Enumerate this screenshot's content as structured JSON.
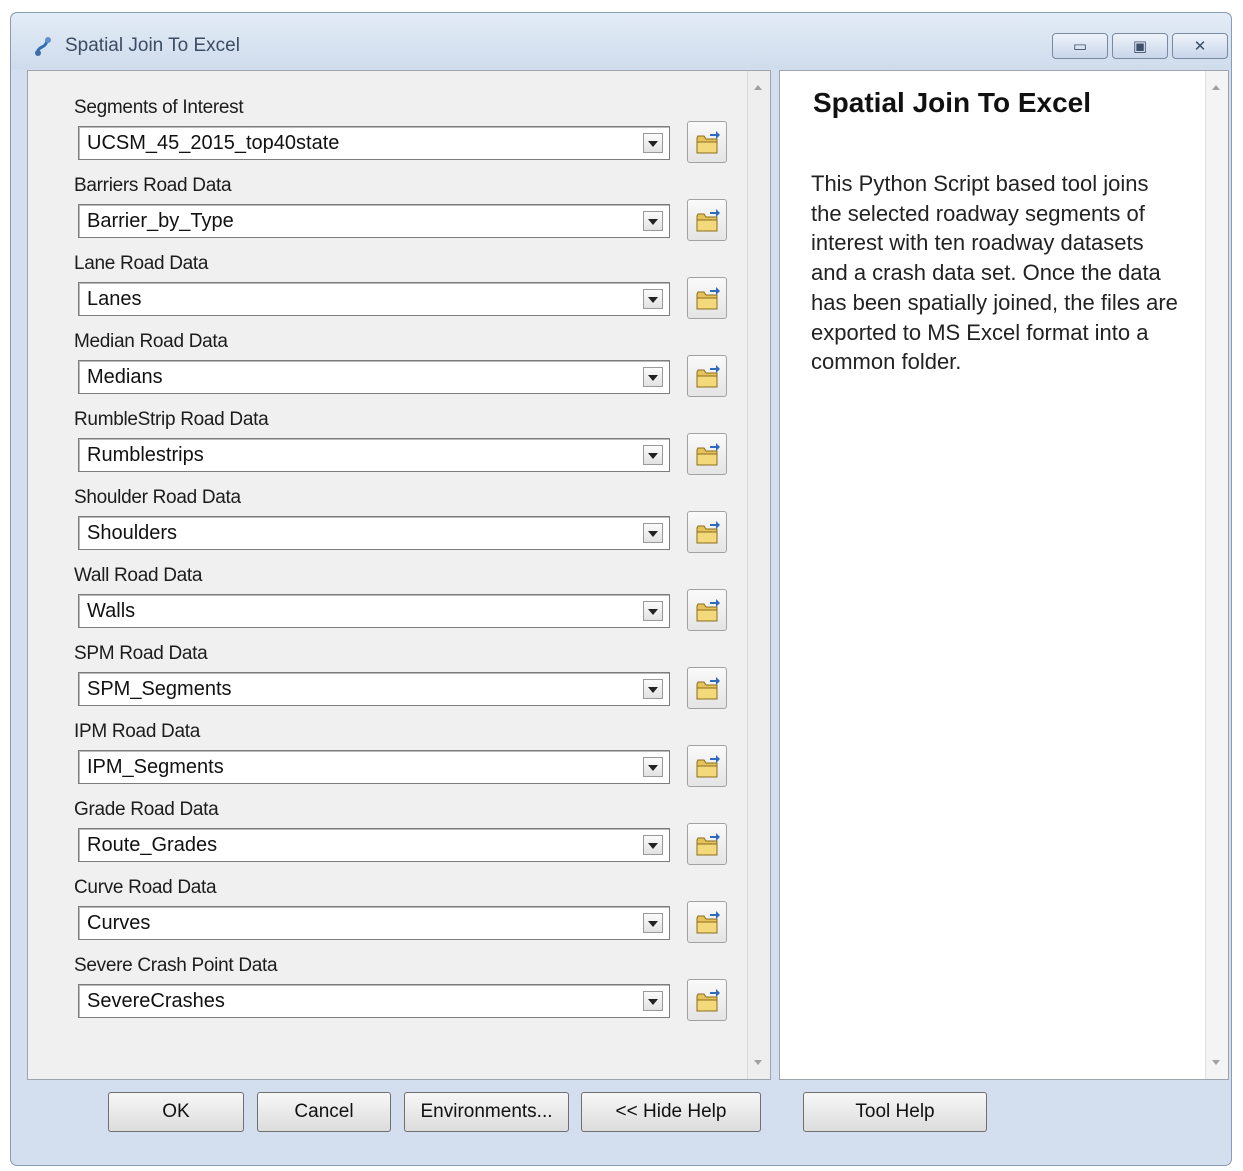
{
  "window": {
    "title": "Spatial Join To Excel",
    "controls": {
      "minimize": "▭",
      "maximize": "▣",
      "close": "✕"
    }
  },
  "fields": [
    {
      "label": "Segments of Interest",
      "value": "UCSM_45_2015_top40state"
    },
    {
      "label": "Barriers Road Data",
      "value": "Barrier_by_Type"
    },
    {
      "label": "Lane Road Data",
      "value": "Lanes"
    },
    {
      "label": "Median Road Data",
      "value": "Medians"
    },
    {
      "label": "RumbleStrip Road Data",
      "value": "Rumblestrips"
    },
    {
      "label": "Shoulder Road Data",
      "value": "Shoulders"
    },
    {
      "label": "Wall Road Data",
      "value": "Walls"
    },
    {
      "label": "SPM Road Data",
      "value": "SPM_Segments"
    },
    {
      "label": "IPM Road Data",
      "value": "IPM_Segments"
    },
    {
      "label": "Grade Road Data",
      "value": "Route_Grades"
    },
    {
      "label": "Curve Road Data",
      "value": "Curves"
    },
    {
      "label": "Severe Crash Point Data",
      "value": "SevereCrashes"
    }
  ],
  "help": {
    "title": "Spatial Join To Excel",
    "body": "This Python Script based tool joins the selected roadway segments of interest with ten roadway datasets and a crash data set. Once the data has been spatially joined, the files are exported to MS Excel format into a common folder."
  },
  "buttons": {
    "ok": "OK",
    "cancel": "Cancel",
    "environments": "Environments...",
    "hide_help": "<< Hide Help",
    "tool_help": "Tool Help"
  },
  "icons": {
    "app": "python-script-tool-icon",
    "browse": "open-folder-icon",
    "dropdown": "chevron-down-icon"
  }
}
